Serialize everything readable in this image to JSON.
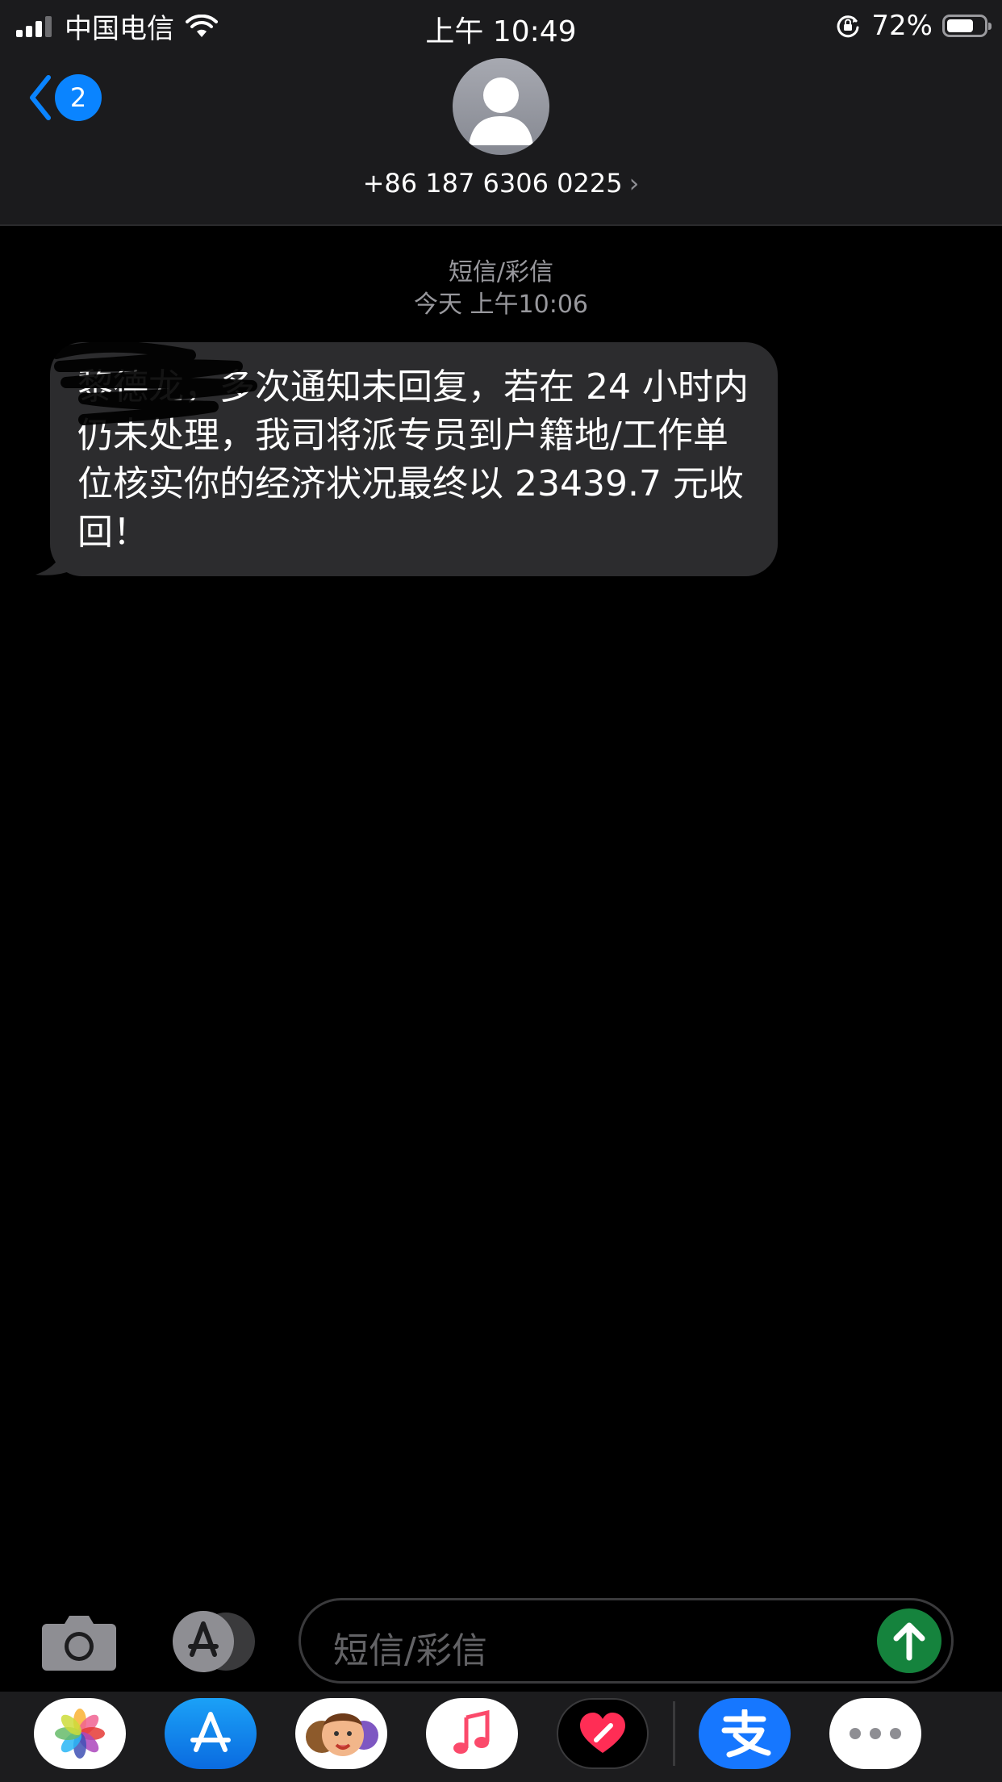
{
  "status_bar": {
    "carrier": "中国电信",
    "time": "上午 10:49",
    "battery_percent": "72%",
    "battery_level": 0.72,
    "icons": [
      "signal-icon",
      "wifi-icon",
      "orientation-lock-icon",
      "battery-icon"
    ]
  },
  "header": {
    "back_badge": "2",
    "contact_number": "+86 187 6306 0225",
    "chevron": "›"
  },
  "conversation": {
    "service_label": "短信/彩信",
    "timestamp": "今天 上午10:06",
    "message_text": "黎德龙，多次通知未回复，若在 24 小时内仍未处理，我司将派专员到户籍地/工作单位核实你的经济状况最终以 23439.7 元收回！"
  },
  "composer": {
    "placeholder": "短信/彩信"
  },
  "app_drawer": {
    "apps": [
      "photos-app-icon",
      "app-store-app-icon",
      "memoji-app-icon",
      "music-app-icon",
      "digital-touch-app-icon",
      "alipay-app-icon",
      "more-apps-icon"
    ]
  },
  "colors": {
    "accent_blue": "#0a84ff",
    "bubble_gray": "#2c2c2e",
    "send_green": "#15833d",
    "background": "#000000"
  }
}
